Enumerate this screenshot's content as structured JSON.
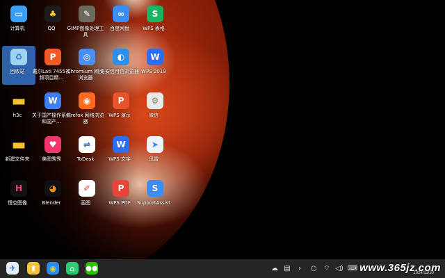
{
  "desktop": {
    "icons": [
      {
        "label": "计算机",
        "icon": "computer-icon",
        "color": "#3b9ef5"
      },
      {
        "label": "QQ",
        "icon": "qq-penguin-icon",
        "color": "#1d1d1d"
      },
      {
        "label": "GIMP图像处理工具",
        "icon": "gimp-icon",
        "color": "#6b6b5e"
      },
      {
        "label": "百度网盘",
        "icon": "baidu-netdisk-icon",
        "color": "#3a8ef5"
      },
      {
        "label": "WPS 表格",
        "icon": "wps-spreadsheet-icon",
        "color": "#1bb461"
      },
      {
        "label": "回收站",
        "icon": "recycle-bin-icon",
        "color": "#9fd3f2"
      },
      {
        "label": "戴尔Lati 7455视频项目精…",
        "icon": "wps-pdf-doc-icon",
        "color": "#f05a28"
      },
      {
        "label": "Chromium 网页浏览器",
        "icon": "chromium-icon",
        "color": "#4a8ff0"
      },
      {
        "label": "奇安信可信浏览器",
        "icon": "qianxin-browser-icon",
        "color": "#2f8fe8"
      },
      {
        "label": "WPS 2019",
        "icon": "wps-2019-icon",
        "color": "#2d6df0"
      },
      {
        "label": "h3c",
        "icon": "folder-icon",
        "color": "#f7c12e"
      },
      {
        "label": "关于国产操作系统和国产…",
        "icon": "wps-writer-doc-icon",
        "color": "#3f7ef0"
      },
      {
        "label": "Firefox 网络浏览器",
        "icon": "firefox-icon",
        "color": "#ff6a1f"
      },
      {
        "label": "WPS 演示",
        "icon": "wps-presentation-icon",
        "color": "#e8532d"
      },
      {
        "label": "微信",
        "icon": "wechat-icon",
        "color": "#e9e9e9"
      },
      {
        "label": "新建文件夹",
        "icon": "folder-icon",
        "color": "#f7c12e"
      },
      {
        "label": "美图秀秀",
        "icon": "meitu-icon",
        "color": "#f0366d"
      },
      {
        "label": "ToDesk",
        "icon": "todesk-icon",
        "color": "#ffffff"
      },
      {
        "label": "WPS 文字",
        "icon": "wps-writer-icon",
        "color": "#2d6df0"
      },
      {
        "label": "迅雷",
        "icon": "xunlei-icon",
        "color": "#eef2fb"
      },
      {
        "label": "悟空图像",
        "icon": "wukong-image-icon",
        "color": "#111111"
      },
      {
        "label": "Blender",
        "icon": "blender-icon",
        "color": "#111111"
      },
      {
        "label": "画图",
        "icon": "paint-icon",
        "color": "#ffffff"
      },
      {
        "label": "WPS PDF",
        "icon": "wps-pdf-icon",
        "color": "#e8443a"
      },
      {
        "label": "SupportAssist",
        "icon": "supportassist-icon",
        "color": "#3d8df2"
      }
    ]
  },
  "taskbar": {
    "apps": [
      {
        "name": "launcher-icon",
        "color": "#e8eef6"
      },
      {
        "name": "file-manager-icon",
        "color": "#f6c33a"
      },
      {
        "name": "browser-icon",
        "color": "#2b8cf0"
      },
      {
        "name": "app-store-icon",
        "color": "#2ecc71"
      },
      {
        "name": "wechat-icon",
        "color": "#2dc100"
      }
    ],
    "tray": [
      "cloud-icon",
      "notes-icon",
      "chevron-right-icon",
      "search-icon",
      "wifi-icon",
      "volume-icon",
      "keyboard-icon"
    ],
    "date": "2024/11/30"
  },
  "watermark": "www.365jz.com"
}
